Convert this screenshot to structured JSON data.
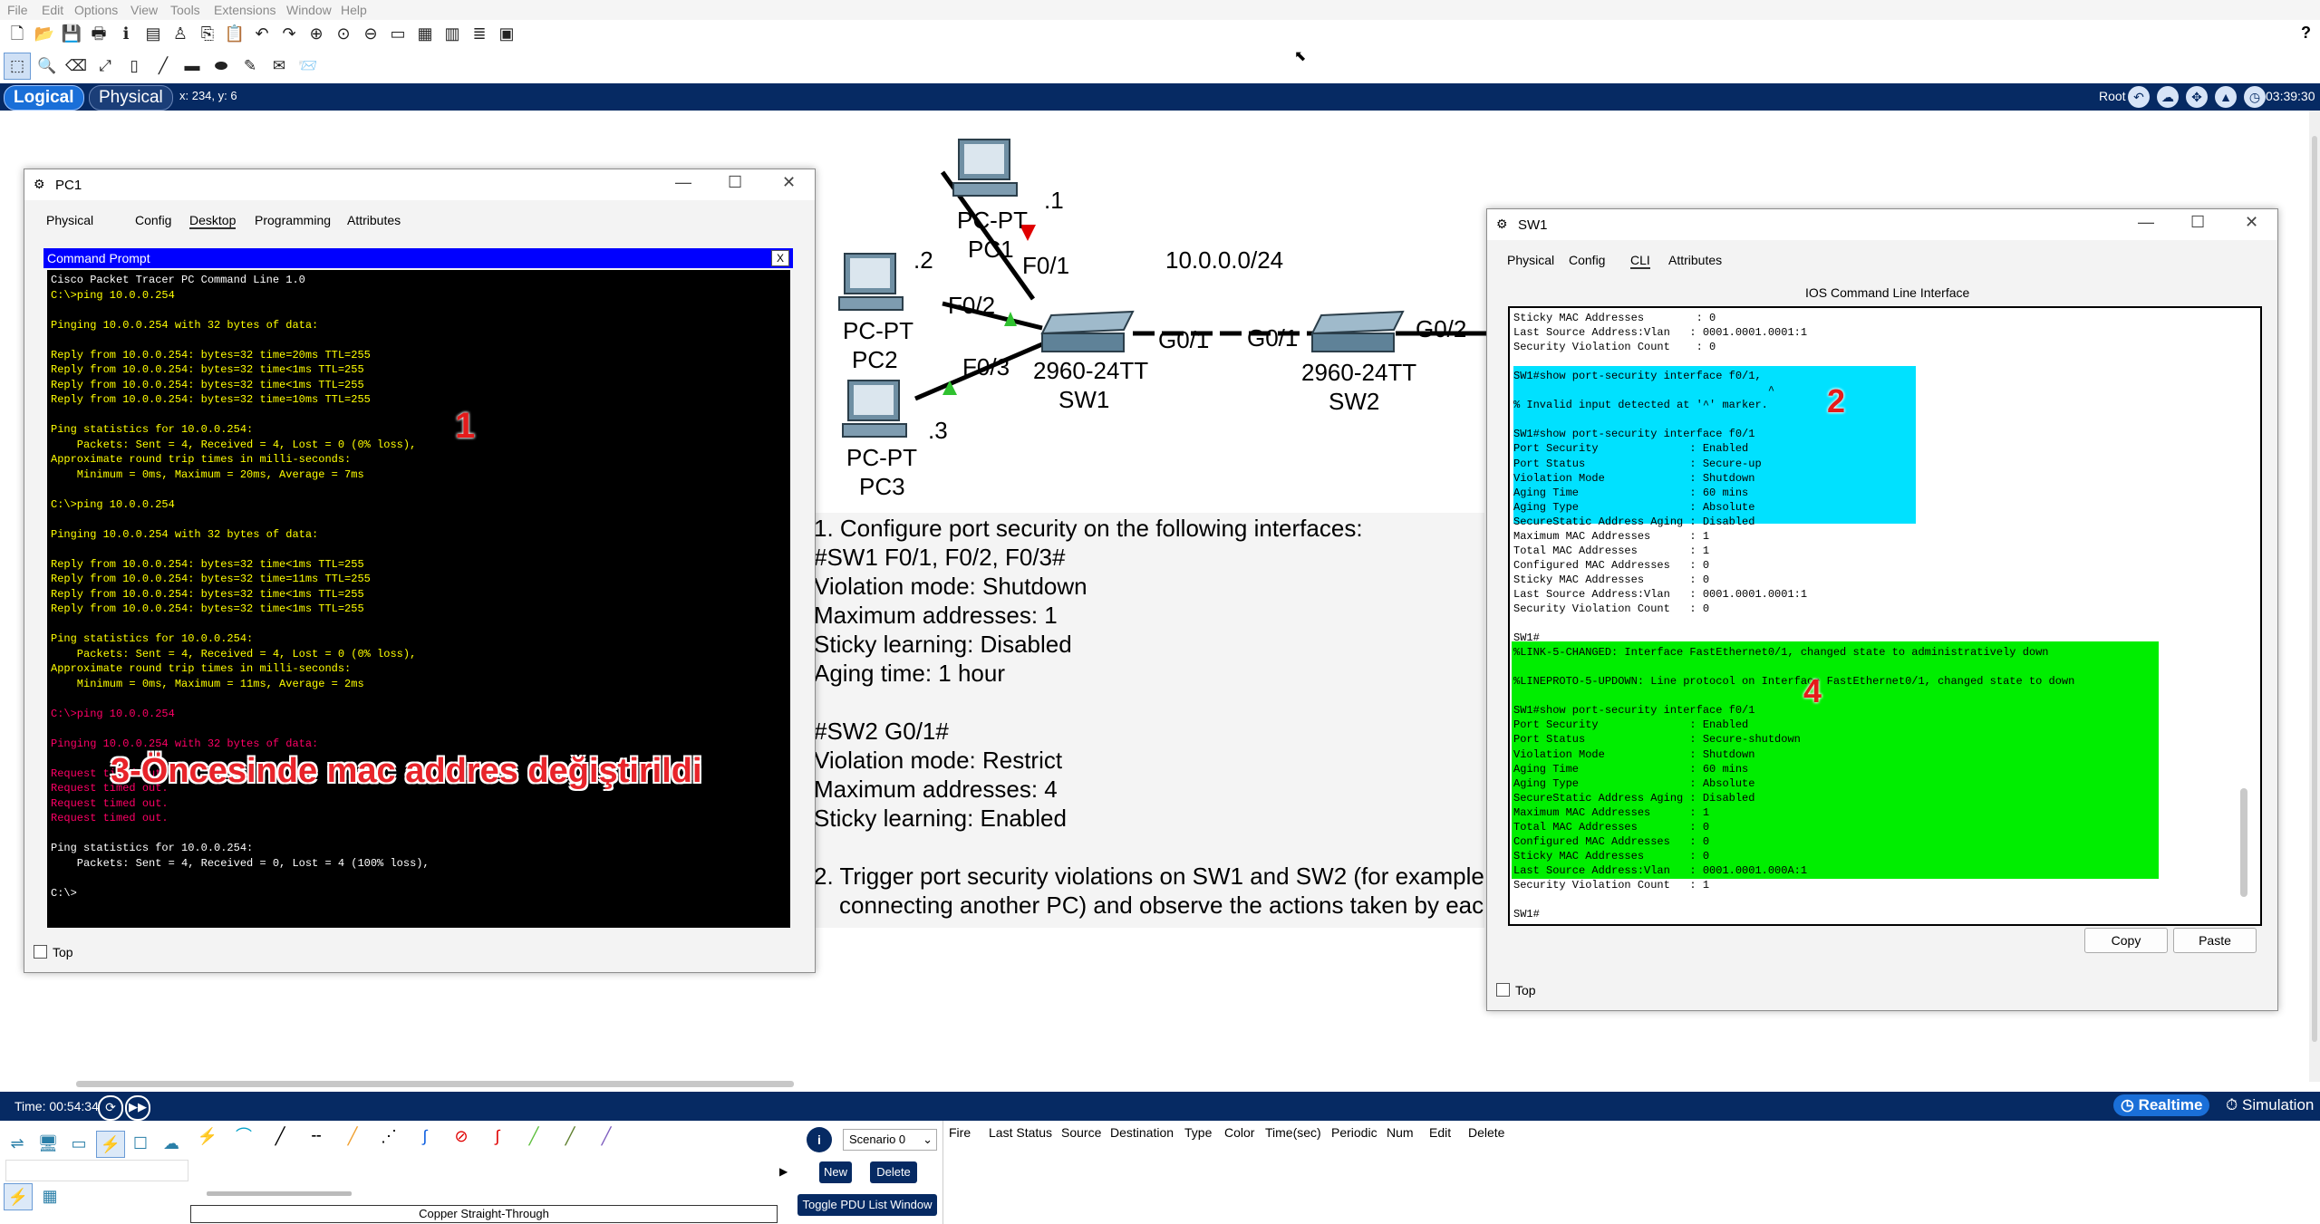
{
  "menubar": [
    "File",
    "Edit",
    "Options",
    "View",
    "Tools",
    "Extensions",
    "Window",
    "Help"
  ],
  "help_icon": "?",
  "workspace": {
    "logical": "Logical",
    "physical": "Physical",
    "coords": "x: 234, y: 6",
    "root": "Root",
    "clock": "03:39:30"
  },
  "topology": {
    "pc1_ip": ".1",
    "pc1_type": "PC-PT",
    "pc1_name": "PC1",
    "pc1_port": "F0/1",
    "pc2_ip": ".2",
    "pc2_type": "PC-PT",
    "pc2_name": "PC2",
    "pc2_port": "F0/2",
    "pc3_ip": ".3",
    "pc3_type": "PC-PT",
    "pc3_name": "PC3",
    "pc3_port": "F0/3",
    "network": "10.0.0.0/24",
    "sw1_model": "2960-24TT",
    "sw1_name": "SW1",
    "sw1_uplink": "G0/1",
    "sw2_model": "2960-24TT",
    "sw2_name": "SW2",
    "sw2_port_left": "G0/1",
    "sw2_port_right": "G0/2"
  },
  "instructions": [
    "1. Configure port security on the following interfaces:",
    "#SW1 F0/1, F0/2, F0/3#",
    "Violation mode: Shutdown",
    "Maximum addresses: 1",
    "Sticky learning: Disabled",
    "Aging time: 1 hour",
    "#SW2 G0/1#",
    "Violation mode: Restrict",
    "Maximum addresses: 4",
    "Sticky learning: Enabled",
    "2. Trigger port security violations on SW1 and SW2 (for example",
    "connecting another PC) and observe the actions taken by eac"
  ],
  "pc1_window": {
    "title": "PC1",
    "tabs": [
      "Physical",
      "Config",
      "Desktop",
      "Programming",
      "Attributes"
    ],
    "cmd_title": "Command Prompt",
    "cmd_close": "X",
    "terminal_lines": [
      "Cisco Packet Tracer PC Command Line 1.0",
      "C:\\>ping 10.0.0.254",
      "",
      "Pinging 10.0.0.254 with 32 bytes of data:",
      "",
      "Reply from 10.0.0.254: bytes=32 time=20ms TTL=255",
      "Reply from 10.0.0.254: bytes=32 time<1ms TTL=255",
      "Reply from 10.0.0.254: bytes=32 time<1ms TTL=255",
      "Reply from 10.0.0.254: bytes=32 time=10ms TTL=255",
      "",
      "Ping statistics for 10.0.0.254:",
      "    Packets: Sent = 4, Received = 4, Lost = 0 (0% loss),",
      "Approximate round trip times in milli-seconds:",
      "    Minimum = 0ms, Maximum = 20ms, Average = 7ms",
      "",
      "C:\\>ping 10.0.0.254",
      "",
      "Pinging 10.0.0.254 with 32 bytes of data:",
      "",
      "Reply from 10.0.0.254: bytes=32 time<1ms TTL=255",
      "Reply from 10.0.0.254: bytes=32 time=11ms TTL=255",
      "Reply from 10.0.0.254: bytes=32 time<1ms TTL=255",
      "Reply from 10.0.0.254: bytes=32 time<1ms TTL=255",
      "",
      "Ping statistics for 10.0.0.254:",
      "    Packets: Sent = 4, Received = 4, Lost = 0 (0% loss),",
      "Approximate round trip times in milli-seconds:",
      "    Minimum = 0ms, Maximum = 11ms, Average = 2ms",
      "",
      "C:\\>ping 10.0.0.254",
      "",
      "Pinging 10.0.0.254 with 32 bytes of data:",
      "",
      "Request timed out.",
      "Request timed out.",
      "Request timed out.",
      "Request timed out.",
      "",
      "Ping statistics for 10.0.0.254:",
      "    Packets: Sent = 4, Received = 0, Lost = 4 (100% loss),",
      "",
      "C:\\>"
    ],
    "annotation_1": "1",
    "annotation_3": "3-Öncesinde mac addres değiştirildi",
    "top_checkbox": "Top"
  },
  "sw1_window": {
    "title": "SW1",
    "tabs": [
      "Physical",
      "Config",
      "CLI",
      "Attributes"
    ],
    "ios_title": "IOS Command Line Interface",
    "cli_lines": [
      "Sticky MAC Addresses        : 0",
      "Last Source Address:Vlan   : 0001.0001.0001:1",
      "Security Violation Count    : 0",
      "",
      "SW1#show port-security interface f0/1,",
      "                                       ^",
      "% Invalid input detected at '^' marker.",
      "",
      "SW1#show port-security interface f0/1",
      "Port Security              : Enabled",
      "Port Status                : Secure-up",
      "Violation Mode             : Shutdown",
      "Aging Time                 : 60 mins",
      "Aging Type                 : Absolute",
      "SecureStatic Address Aging : Disabled",
      "Maximum MAC Addresses      : 1",
      "Total MAC Addresses        : 1",
      "Configured MAC Addresses   : 0",
      "Sticky MAC Addresses       : 0",
      "Last Source Address:Vlan   : 0001.0001.0001:1",
      "Security Violation Count   : 0",
      "",
      "SW1#",
      "%LINK-5-CHANGED: Interface FastEthernet0/1, changed state to administratively down",
      "",
      "%LINEPROTO-5-UPDOWN: Line protocol on Interface FastEthernet0/1, changed state to down",
      "",
      "SW1#show port-security interface f0/1",
      "Port Security              : Enabled",
      "Port Status                : Secure-shutdown",
      "Violation Mode             : Shutdown",
      "Aging Time                 : 60 mins",
      "Aging Type                 : Absolute",
      "SecureStatic Address Aging : Disabled",
      "Maximum MAC Addresses      : 1",
      "Total MAC Addresses        : 0",
      "Configured MAC Addresses   : 0",
      "Sticky MAC Addresses       : 0",
      "Last Source Address:Vlan   : 0001.0001.000A:1",
      "Security Violation Count   : 1",
      "",
      "SW1#"
    ],
    "annotation_2": "2",
    "annotation_4": "4",
    "copy": "Copy",
    "paste": "Paste",
    "top_checkbox": "Top"
  },
  "bottom": {
    "time": "Time: 00:54:34",
    "realtime": "Realtime",
    "simulation": "Simulation",
    "scenario": "Scenario 0",
    "new": "New",
    "delete": "Delete",
    "toggle_pdu": "Toggle PDU List Window",
    "connection_label": "Copper Straight-Through",
    "pdu_columns": [
      "Fire",
      "Last Status",
      "Source",
      "Destination",
      "Type",
      "Color",
      "Time(sec)",
      "Periodic",
      "Num",
      "Edit",
      "Delete"
    ]
  },
  "colors": {
    "workspace_bar": "#062a63",
    "terminal_yellow": "#ffff00",
    "terminal_magenta": "#ff0066",
    "highlight_cyan": "#00e1ff",
    "highlight_green": "#00ee00",
    "annotation_red": "#e51b1b"
  }
}
